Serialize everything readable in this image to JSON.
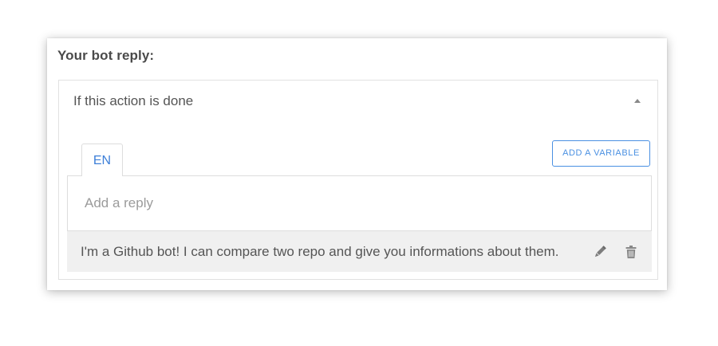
{
  "card": {
    "title": "Your bot reply:"
  },
  "panel": {
    "header": "If this action is done",
    "collapse_icon": "caret-up-icon"
  },
  "tabs": [
    {
      "label": "EN",
      "active": true
    }
  ],
  "add_variable_button": "ADD A VARIABLE",
  "reply_input": {
    "placeholder": "Add a reply",
    "value": ""
  },
  "replies": [
    {
      "text": "I'm a Github bot! I can compare two repo and give you informations about them.",
      "edit_icon": "pencil-icon",
      "delete_icon": "trash-icon"
    }
  ],
  "colors": {
    "accent": "#4a90e2",
    "tab_text": "#3d7fd8",
    "row_background": "#f0f0f0",
    "title_text": "#4a4a4a"
  }
}
